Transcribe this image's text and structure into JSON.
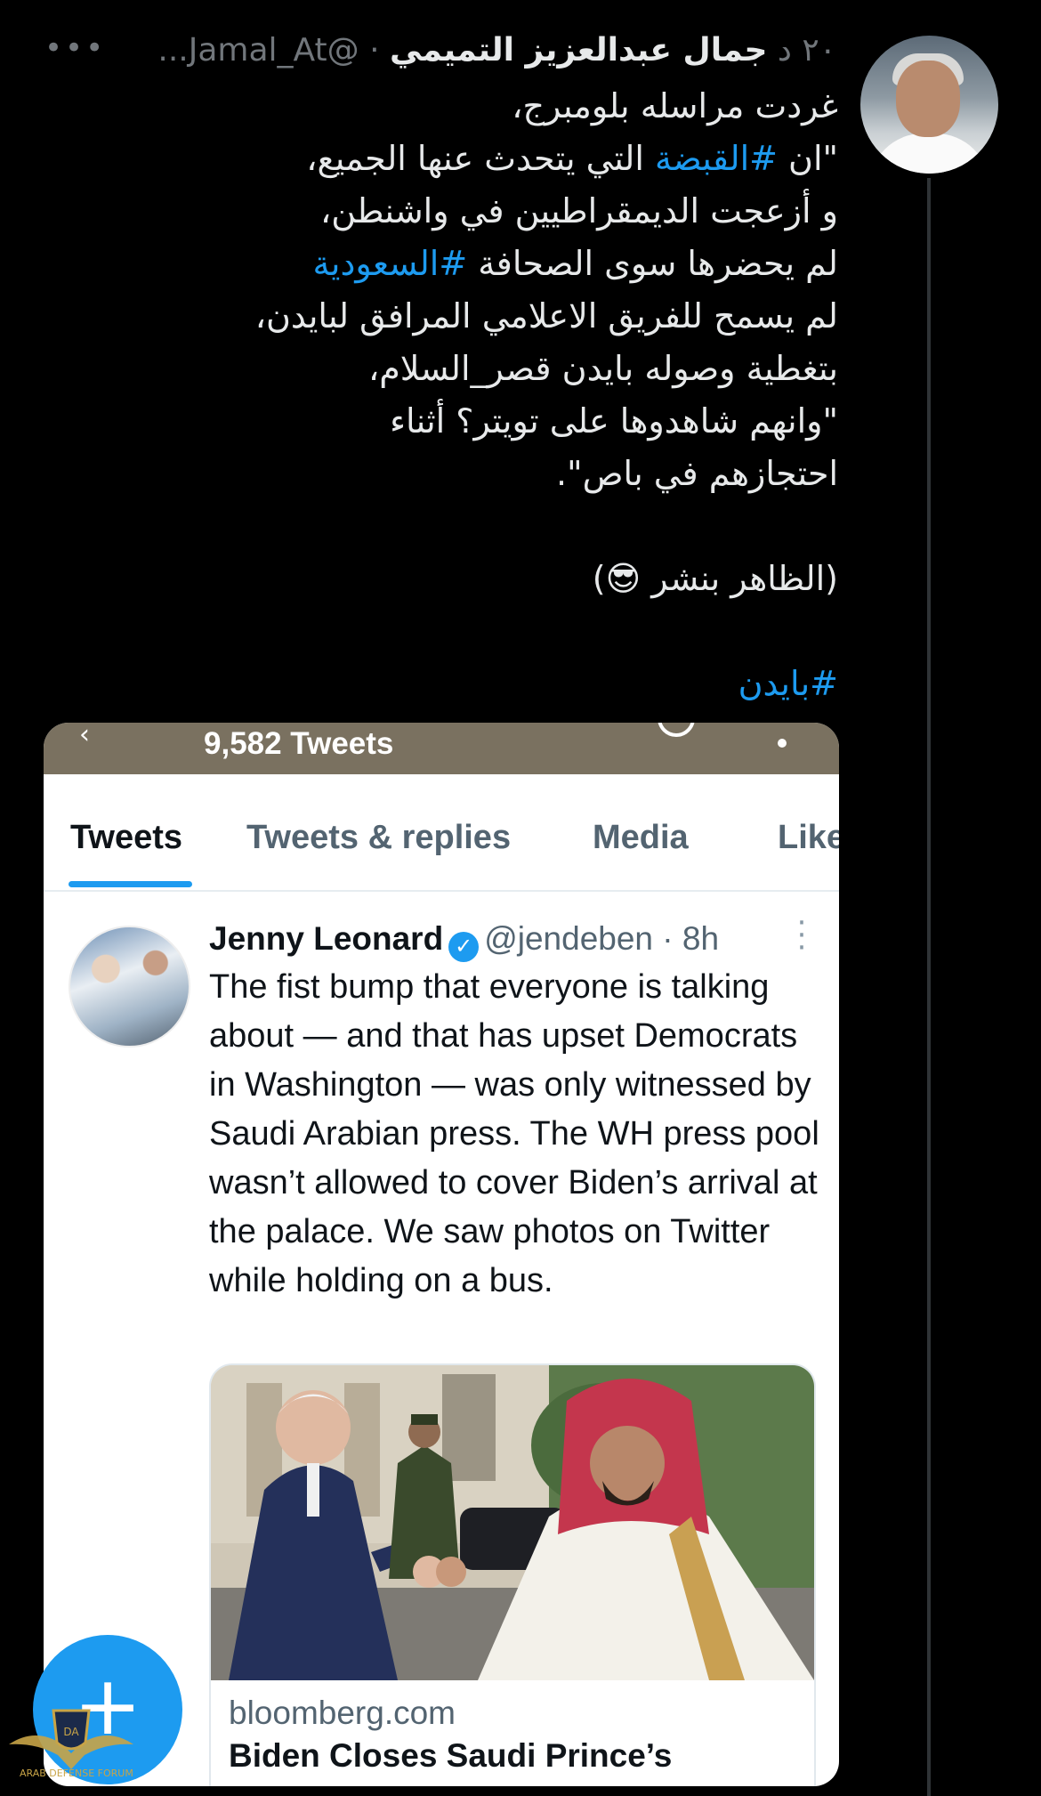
{
  "tweet": {
    "user_name": "جمال عبدالعزيز التميمي",
    "handle_time": " ...Jamal_At@ · ٢٠ د",
    "more_icon": "ellipsis-icon",
    "lines": [
      {
        "text": "غردت مراسله بلومبرج،"
      },
      {
        "text": "\"ان ",
        "tag": "#القبضة",
        "after": " التي يتحدث عنها الجميع،"
      },
      {
        "text": "و أزعجت الديمقراطيين في واشنطن،"
      },
      {
        "text": "لم يحضرها سوى الصحافة ",
        "tag": "#السعودية",
        "after": ""
      },
      {
        "text": "لم يسمح للفريق الاعلامي المرافق لبايدن،"
      },
      {
        "text": "بتغطية وصوله بايدن قصر_السلام،"
      },
      {
        "text": "\"وانهم شاهدوها على تويتر؟ أثناء"
      },
      {
        "text": "احتجازهم في باص\"."
      },
      {
        "text": ""
      },
      {
        "text": "(الظاهر بنشر 😎)"
      },
      {
        "text": ""
      },
      {
        "text": "",
        "tag": "#بايدن",
        "after": ""
      }
    ]
  },
  "embedded": {
    "tweet_count": "9,582 Tweets",
    "tabs": [
      "Tweets",
      "Tweets & replies",
      "Media",
      "Like"
    ],
    "active_tab": "Tweets",
    "author_name": "Jenny Leonard",
    "author_handle_time": "@jendeben · 8h",
    "verified_icon": "verified-badge-icon",
    "text": "The fist bump that everyone is talking about — and that has upset Democrats in Washington — was only witnessed by Saudi Arabian press. The WH press pool wasn’t allowed to cover Biden’s arrival at the palace. We saw photos on Twitter while holding on a bus.",
    "link_domain": "bloomberg.com",
    "link_title": "Biden Closes Saudi Prince’s"
  },
  "fab_icon": "compose-plus-icon",
  "watermark": "ARAB DEFENSE FORUM",
  "colors": {
    "background": "#000000",
    "hashtag": "#1d9bf0",
    "card_topbar": "#7a7160",
    "tab_indicator": "#1d9bf0"
  }
}
